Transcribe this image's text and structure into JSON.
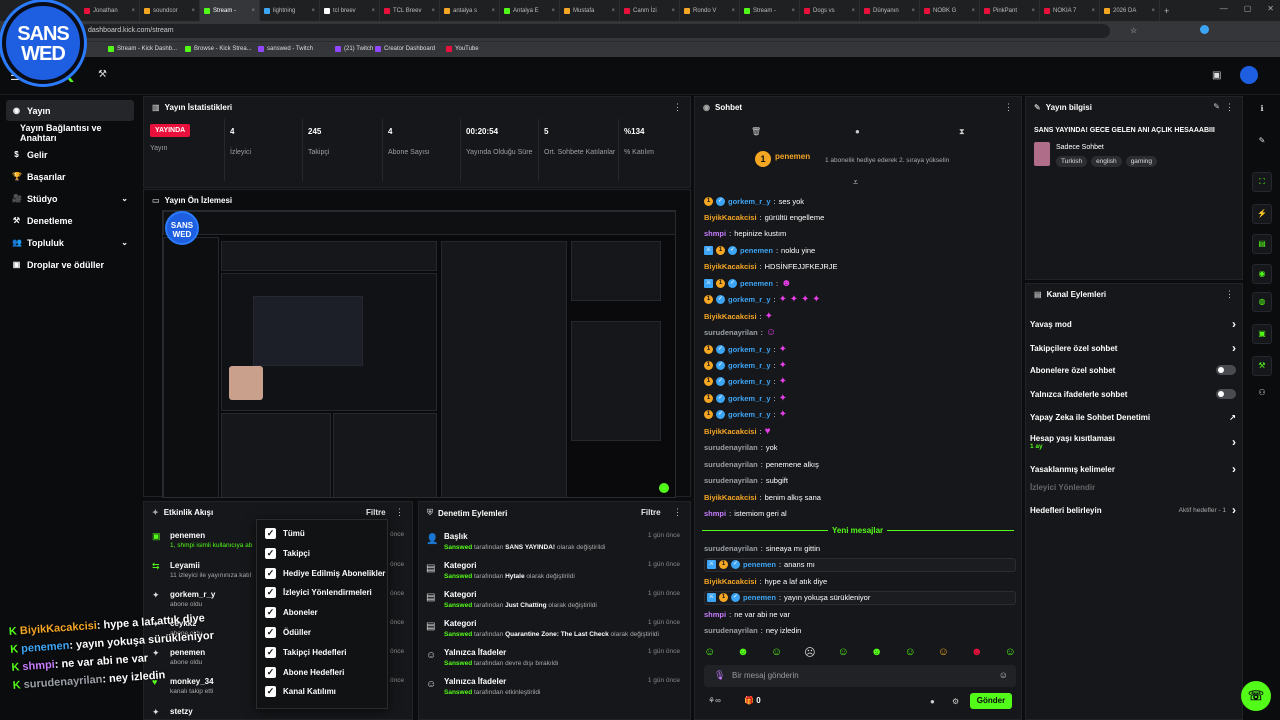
{
  "browser": {
    "tabs": [
      "Jonathan",
      "soundcor",
      "Stream -",
      "lightning",
      "tcl breev",
      "TCL Breev",
      "antalya s",
      "Antalya E",
      "Mustafa",
      "Canm İzi",
      "Rondo V",
      "Stream -",
      "Dogs vs",
      "Dünyanın",
      "NOBK G",
      "PinkPant",
      "NOKIA 7",
      "2026 DA"
    ],
    "url": "dashboard.kick.com/stream",
    "bookmarks": [
      "Stream - Kick Dashb...",
      "Browse - Kick Strea...",
      "sanswed - Twitch",
      "(21) Twitch",
      "Creator Dashboard",
      "YouTube"
    ]
  },
  "logo": "KICK",
  "leftnav": {
    "items": [
      "Yayın",
      "Yayın Bağlantısı ve Anahtarı",
      "Gelir",
      "Başarılar",
      "Stüdyo",
      "Denetleme",
      "Topluluk",
      "Droplar ve ödüller"
    ]
  },
  "stats": {
    "title": "Yayın İstatistikleri",
    "live_badge": "YAYINDA",
    "live_label": "Yayın",
    "items": [
      {
        "value": "4",
        "label": "İzleyici"
      },
      {
        "value": "245",
        "label": "Takipçi"
      },
      {
        "value": "4",
        "label": "Abone Sayısı"
      },
      {
        "value": "00:20:54",
        "label": "Yayında Olduğu Süre"
      },
      {
        "value": "5",
        "label": "Ort. Sohbete Katılanlar"
      },
      {
        "value": "%134",
        "label": "% Katılım"
      }
    ]
  },
  "preview": {
    "title": "Yayın Ön İzlemesi"
  },
  "activity": {
    "title": "Etkinlik Akışı",
    "filter": "Filtre",
    "items": [
      {
        "name": "penemen",
        "desc": "1, shmpi isimli kullanıcıya ab",
        "ago": "önce"
      },
      {
        "name": "Leyamii",
        "desc": "11 izleyici ile yayınınıza katıl",
        "ago": "önce"
      },
      {
        "name": "gorkem_r_y",
        "desc": "abone oldu",
        "ago": "önce"
      },
      {
        "name": "ceykkz",
        "desc": "abone oldu",
        "ago": "önce"
      },
      {
        "name": "penemen",
        "desc": "abone oldu",
        "ago": "önce"
      },
      {
        "name": "monkey_34",
        "desc": "kanalı takip etti",
        "ago": "önce"
      },
      {
        "name": "stetzy",
        "desc": "",
        "ago": ""
      }
    ]
  },
  "filter_menu": {
    "items": [
      "Tümü",
      "Takipçi",
      "Hediye Edilmiş Abonelikler",
      "İzleyici Yönlendirmeleri",
      "Aboneler",
      "Ödüller",
      "Takipçi Hedefleri",
      "Abone Hedefleri",
      "Kanal Katılımı"
    ]
  },
  "modlog": {
    "title": "Denetim Eylemleri",
    "filter": "Filtre",
    "items": [
      {
        "title": "Başlık",
        "by": "Sanswed",
        "pre": " tarafından ",
        "what": "SANS YAYINDA!",
        "post": " olarak değiştirildi",
        "ago": "1 gün önce"
      },
      {
        "title": "Kategori",
        "by": "Sanswed",
        "pre": " tarafından ",
        "what": "Hytale",
        "post": " olarak değiştirildi",
        "ago": "1 gün önce"
      },
      {
        "title": "Kategori",
        "by": "Sanswed",
        "pre": " tarafından ",
        "what": "Just Chatting",
        "post": " olarak değiştirildi",
        "ago": "1 gün önce"
      },
      {
        "title": "Kategori",
        "by": "Sanswed",
        "pre": " tarafından ",
        "what": "Quarantine Zone: The Last Check",
        "post": " olarak değiştirildi",
        "ago": "1 gün önce"
      },
      {
        "title": "Yalnızca İfadeler",
        "by": "Sanswed",
        "pre": " tarafından devre dışı bırakıldı",
        "what": "",
        "post": "",
        "ago": "1 gün önce"
      },
      {
        "title": "Yalnızca İfadeler",
        "by": "Sanswed",
        "pre": " tarafından etkinleştirildi",
        "what": "",
        "post": "",
        "ago": "1 gün önce"
      }
    ]
  },
  "chat": {
    "title": "Sohbet",
    "pinned_user": "penemen",
    "pinned_count": "1",
    "pinned_text": "1 abonelik hediye ederek 2. sıraya yükselin",
    "messages": [
      {
        "user": "gorkem_r_y",
        "color": "#3da5f5",
        "text": "ses yok",
        "badges": "12"
      },
      {
        "user": "BiyikKacakcisi",
        "color": "#f5a623",
        "text": "gürültü engelleme",
        "badges": ""
      },
      {
        "user": "shmpi",
        "color": "#c77dff",
        "text": "hepinize kustım",
        "badges": ""
      },
      {
        "user": "penemen",
        "color": "#3da5f5",
        "text": "noldu yine",
        "badges": "312"
      },
      {
        "user": "BiyikKacakcisi",
        "color": "#f5a623",
        "text": "HDSİNFEJJFKEJRJE",
        "badges": ""
      },
      {
        "user": "penemen",
        "color": "#3da5f5",
        "text": "",
        "badges": "312",
        "emote": "☻"
      },
      {
        "user": "gorkem_r_y",
        "color": "#3da5f5",
        "text": "",
        "badges": "12",
        "emote": "✦ ✦ ✦ ✦"
      },
      {
        "user": "BiyikKacakcisi",
        "color": "#f5a623",
        "text": "",
        "badges": "",
        "emote": "✦"
      },
      {
        "user": "surudenayrilan",
        "color": "#9aa0a6",
        "text": "",
        "badges": "",
        "emote": "☺"
      },
      {
        "user": "gorkem_r_y",
        "color": "#3da5f5",
        "text": "",
        "badges": "12",
        "emote": "✦"
      },
      {
        "user": "gorkem_r_y",
        "color": "#3da5f5",
        "text": "",
        "badges": "12",
        "emote": "✦"
      },
      {
        "user": "gorkem_r_y",
        "color": "#3da5f5",
        "text": "",
        "badges": "12",
        "emote": "✦"
      },
      {
        "user": "gorkem_r_y",
        "color": "#3da5f5",
        "text": "",
        "badges": "12",
        "emote": "✦"
      },
      {
        "user": "gorkem_r_y",
        "color": "#3da5f5",
        "text": "",
        "badges": "12",
        "emote": "✦"
      },
      {
        "user": "BiyikKacakcisi",
        "color": "#f5a623",
        "text": "",
        "badges": "",
        "emote": "♥"
      },
      {
        "user": "surudenayrilan",
        "color": "#9aa0a6",
        "text": "yok",
        "badges": ""
      },
      {
        "user": "surudenayrilan",
        "color": "#9aa0a6",
        "text": "penemene alkış",
        "badges": ""
      },
      {
        "user": "surudenayrilan",
        "color": "#9aa0a6",
        "text": "subgift",
        "badges": ""
      },
      {
        "user": "BiyikKacakcisi",
        "color": "#f5a623",
        "text": "benim alkış sana",
        "badges": ""
      },
      {
        "user": "shmpi",
        "color": "#c77dff",
        "text": "istemiom geri al",
        "badges": ""
      }
    ],
    "new_messages": "Yeni mesajlar",
    "new": [
      {
        "user": "surudenayrilan",
        "color": "#9aa0a6",
        "text": "sineaya mı gittin",
        "badges": "",
        "hl": false
      },
      {
        "user": "penemen",
        "color": "#3da5f5",
        "text": "anans mı",
        "badges": "312",
        "hl": true
      },
      {
        "user": "BiyikKacakcisi",
        "color": "#f5a623",
        "text": "hype a laf atık diye",
        "badges": "",
        "hl": false
      },
      {
        "user": "penemen",
        "color": "#3da5f5",
        "text": "yayın yokuşa sürükleniyor",
        "badges": "312",
        "hl": true
      },
      {
        "user": "shmpi",
        "color": "#c77dff",
        "text": "ne var abi ne var",
        "badges": "",
        "hl": false
      },
      {
        "user": "surudenayrilan",
        "color": "#9aa0a6",
        "text": "ney izledin",
        "badges": "",
        "hl": false
      }
    ],
    "placeholder": "Bir mesaj gönderin",
    "points": "0",
    "send": "Gönder"
  },
  "stream_info": {
    "title": "Yayın bilgisi",
    "stream_title": "SANS YAYINDA! GECE GELEN ANİ AÇLIK HESAAABIII",
    "category": "Sadece Sohbet",
    "tags": [
      "Turkish",
      "english",
      "gaming"
    ]
  },
  "channel_actions": {
    "title": "Kanal Eylemleri",
    "items": [
      {
        "label": "Yavaş mod",
        "kind": "chev"
      },
      {
        "label": "Takipçilere özel sohbet",
        "kind": "chev"
      },
      {
        "label": "Abonelere özel sohbet",
        "kind": "toggle"
      },
      {
        "label": "Yalnızca ifadelerle sohbet",
        "kind": "toggle"
      },
      {
        "label": "Yapay Zeka ile Sohbet Denetimi",
        "kind": "ext"
      },
      {
        "label": "Hesap yaşı kısıtlaması",
        "kind": "chev",
        "sub": "1 ay"
      },
      {
        "label": "Yasaklanmış kelimeler",
        "kind": "chev"
      },
      {
        "label": "İzleyici Yönlendir",
        "kind": "disabled"
      },
      {
        "label": "Hedefleri belirleyin",
        "kind": "chev",
        "sub2": "Aktif hedefler - 1"
      }
    ]
  },
  "overlay": {
    "logo_line1": "SANS",
    "logo_line2": "WED",
    "lines": [
      {
        "user": "BiyikKacakcisi",
        "text": ": hype a laf attık diye",
        "color": "#f5a623"
      },
      {
        "user": "penemen",
        "text": ": yayın yokuşa sürükleniyor",
        "color": "#3da5f5"
      },
      {
        "user": "shmpi",
        "text": ": ne var abi ne var",
        "color": "#c77dff"
      },
      {
        "user": "surudenayrilan",
        "text": ": ney izledin",
        "color": "#9aa0a6"
      }
    ]
  },
  "colors": {
    "accent": "#53fc18",
    "live": "#e9113c",
    "panel": "#16171a"
  }
}
